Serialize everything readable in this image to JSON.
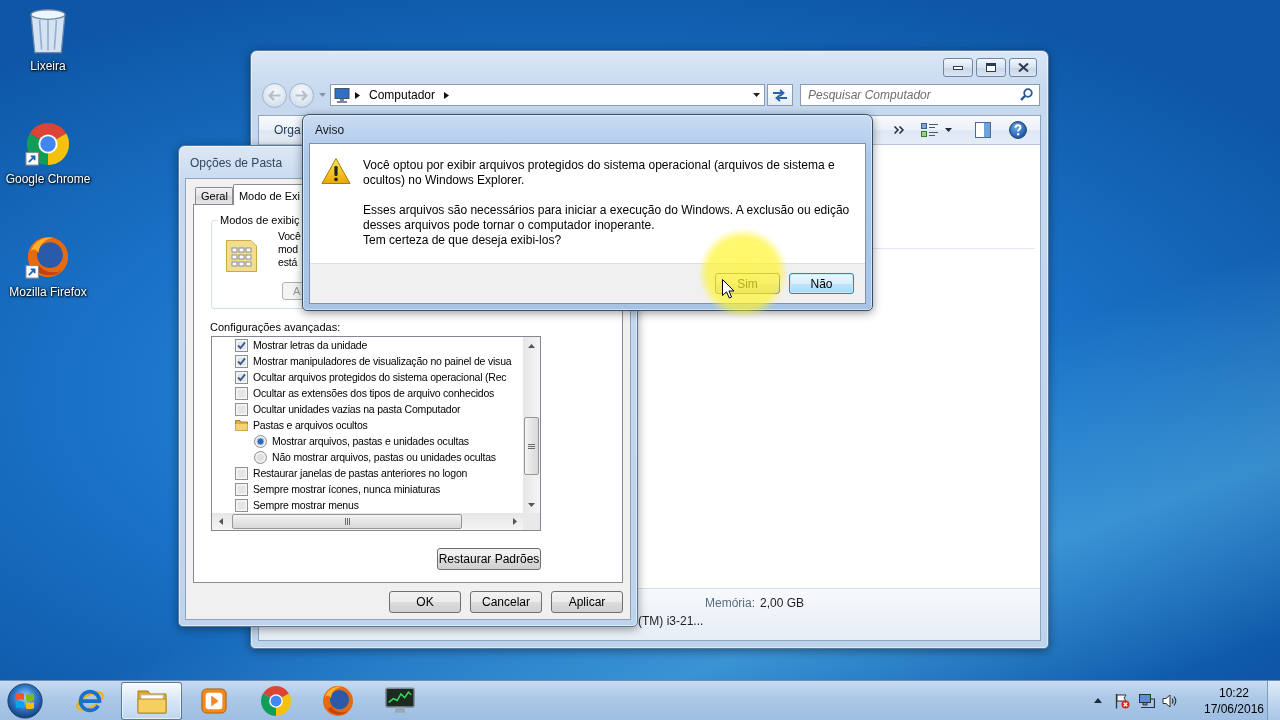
{
  "desktop": {
    "shortcuts": [
      {
        "label": "Lixeira",
        "kind": "recycle-bin"
      },
      {
        "label": "Google Chrome",
        "kind": "chrome"
      },
      {
        "label": "Mozilla Firefox",
        "kind": "firefox"
      }
    ]
  },
  "explorer": {
    "nav_buttons": [
      {
        "kind": "back",
        "disabled": true
      },
      {
        "kind": "forward",
        "disabled": true
      }
    ],
    "address": {
      "location": "Computador"
    },
    "search": {
      "placeholder": "Pesquisar Computador"
    },
    "toolbar": {
      "menu": "Orga"
    },
    "details": {
      "memory_label": "Memória:",
      "memory_value": "2,00 GB",
      "processor": "(TM) i3-21..."
    }
  },
  "folder_options": {
    "title": "Opções de Pasta",
    "tabs": [
      {
        "label": "Geral",
        "selected": false
      },
      {
        "label": "Modo de Exi",
        "selected": true
      }
    ],
    "view_group": {
      "legend": "Modos de exibiç",
      "lines": [
        "Você",
        "mod",
        "está"
      ],
      "button": {
        "label": "A",
        "disabled": true
      }
    },
    "advanced_label": "Configurações avançadas:",
    "settings": [
      {
        "kind": "checkbox",
        "label": "Mostrar letras da unidade",
        "checked": true
      },
      {
        "kind": "checkbox",
        "label": "Mostrar manipuladores de visualização no painel de visua",
        "checked": true
      },
      {
        "kind": "checkbox",
        "label": "Ocultar arquivos protegidos do sistema operacional (Rec",
        "checked": true
      },
      {
        "kind": "checkbox",
        "label": "Ocultar as extensões dos tipos de arquivo conhecidos",
        "checked": false
      },
      {
        "kind": "checkbox",
        "label": "Ocultar unidades vazias na pasta Computador",
        "checked": false
      },
      {
        "kind": "folder",
        "label": "Pastas e arquivos ocultos",
        "children": [
          {
            "kind": "radio",
            "label": "Mostrar arquivos, pastas e unidades ocultas",
            "selected": true
          },
          {
            "kind": "radio",
            "label": "Não mostrar arquivos, pastas ou unidades ocultas",
            "selected": false
          }
        ]
      },
      {
        "kind": "checkbox",
        "label": "Restaurar janelas de pastas anteriores no logon",
        "checked": false
      },
      {
        "kind": "checkbox",
        "label": "Sempre mostrar ícones, nunca miniaturas",
        "checked": false
      },
      {
        "kind": "checkbox",
        "label": "Sempre mostrar menus",
        "checked": false
      }
    ],
    "restore_button": "Restaurar Padrões",
    "buttons": [
      "OK",
      "Cancelar",
      "Aplicar"
    ]
  },
  "warning": {
    "title": "Aviso",
    "paragraphs": [
      [
        "Você optou por exibir arquivos protegidos do sistema operacional (arquivos de sistema e ocultos) no Windows Explorer."
      ],
      [
        "Esses arquivos são necessários para iniciar a execução do Windows. A exclusão ou edição desses arquivos pode tornar o computador inoperante.",
        "Tem certeza de que deseja exibi-los?"
      ]
    ],
    "buttons": [
      {
        "label": "Sim",
        "default": false
      },
      {
        "label": "Não",
        "default": true
      }
    ]
  },
  "taskbar": {
    "apps": [
      {
        "kind": "ie",
        "active": false
      },
      {
        "kind": "explorer",
        "active": true
      },
      {
        "kind": "media-player",
        "active": false
      },
      {
        "kind": "chrome",
        "active": false
      },
      {
        "kind": "firefox",
        "active": false
      },
      {
        "kind": "monitor",
        "active": false
      }
    ],
    "clock": {
      "time": "10:22",
      "date": "17/06/2016"
    }
  }
}
